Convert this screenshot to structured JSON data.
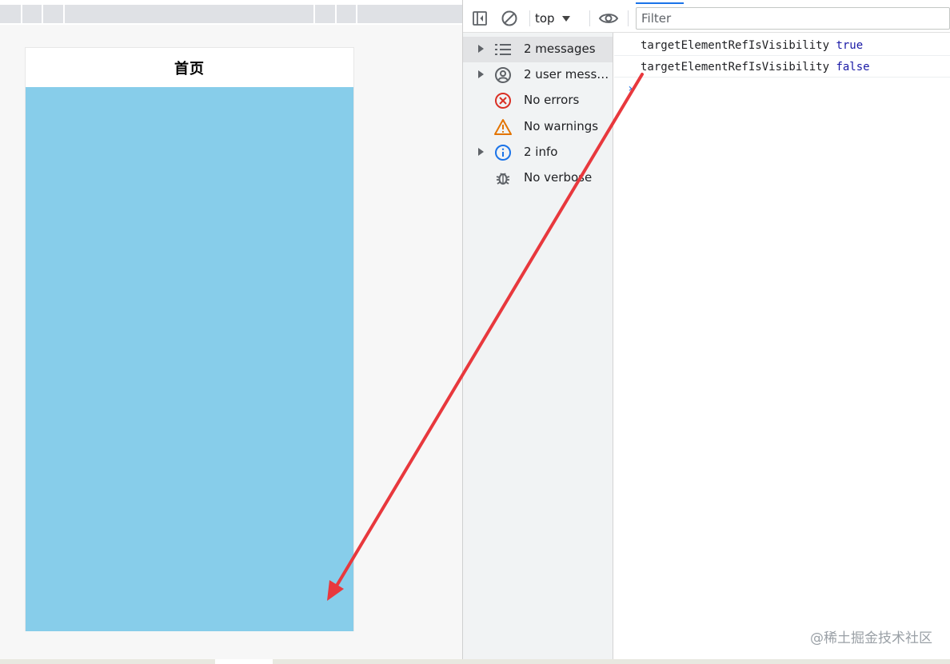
{
  "colors": {
    "preview_body": "#87cdea",
    "arrow": "#e8383d",
    "error": "#d93025",
    "warning": "#e37400",
    "info": "#1a73e8",
    "log_value": "#1a1aa6"
  },
  "preview": {
    "nav_title": "首页"
  },
  "devtools": {
    "toolbar": {
      "context": "top",
      "filter_placeholder": "Filter"
    },
    "sidebar": {
      "items": [
        {
          "label": "2 messages",
          "icon": "list-icon",
          "expandable": true,
          "selected": true
        },
        {
          "label": "2 user messa...",
          "icon": "user-icon",
          "expandable": true,
          "selected": false
        },
        {
          "label": "No errors",
          "icon": "error-icon",
          "expandable": false,
          "selected": false
        },
        {
          "label": "No warnings",
          "icon": "warning-icon",
          "expandable": false,
          "selected": false
        },
        {
          "label": "2 info",
          "icon": "info-icon",
          "expandable": true,
          "selected": false
        },
        {
          "label": "No verbose",
          "icon": "bug-icon",
          "expandable": false,
          "selected": false
        }
      ]
    },
    "console": {
      "logs": [
        {
          "key": "targetElementRefIsVisibility",
          "value": "true"
        },
        {
          "key": "targetElementRefIsVisibility",
          "value": "false"
        }
      ],
      "prompt": "›"
    }
  },
  "watermark": "@稀土掘金技术社区"
}
